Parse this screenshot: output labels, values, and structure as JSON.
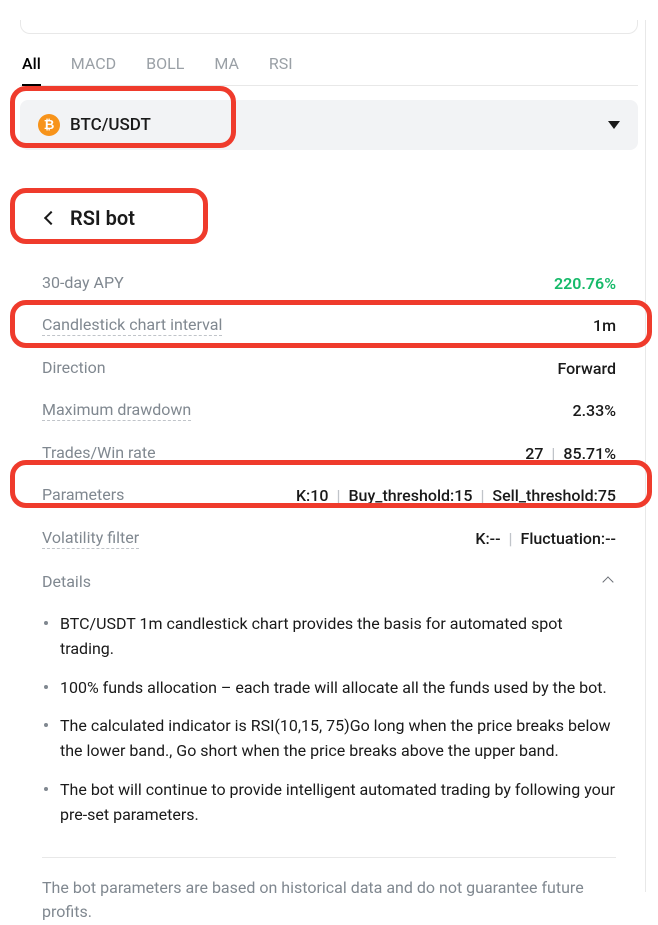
{
  "tabs": [
    "All",
    "MACD",
    "BOLL",
    "MA",
    "RSI"
  ],
  "pair": {
    "symbol": "BTC/USDT",
    "icon": "₿"
  },
  "bot": {
    "title": "RSI bot"
  },
  "stats": {
    "apy_label": "30-day APY",
    "apy_value": "220.76%",
    "interval_label": "Candlestick chart interval",
    "interval_value": "1m",
    "direction_label": "Direction",
    "direction_value": "Forward",
    "drawdown_label": "Maximum drawdown",
    "drawdown_value": "2.33%",
    "trades_label": "Trades/Win rate",
    "trades_value_a": "27",
    "trades_value_b": "85.71%",
    "params_label": "Parameters",
    "params_k": "K:10",
    "params_buy": "Buy_threshold:15",
    "params_sell": "Sell_threshold:75",
    "volatility_label": "Volatility filter",
    "volatility_k": "K:--",
    "volatility_fluct": "Fluctuation:--"
  },
  "details": {
    "label": "Details",
    "items": [
      "BTC/USDT 1m candlestick chart provides the basis for automated spot trading.",
      "100% funds allocation – each trade will allocate all the funds used by the bot.",
      "The calculated indicator is RSI(10,15, 75)Go long when the price breaks below the lower band., Go short when the price breaks above the upper band.",
      "The bot will continue to provide intelligent automated trading by following your pre-set parameters."
    ],
    "disclaimer": "The bot parameters are based on historical data and do not guarantee future profits."
  }
}
